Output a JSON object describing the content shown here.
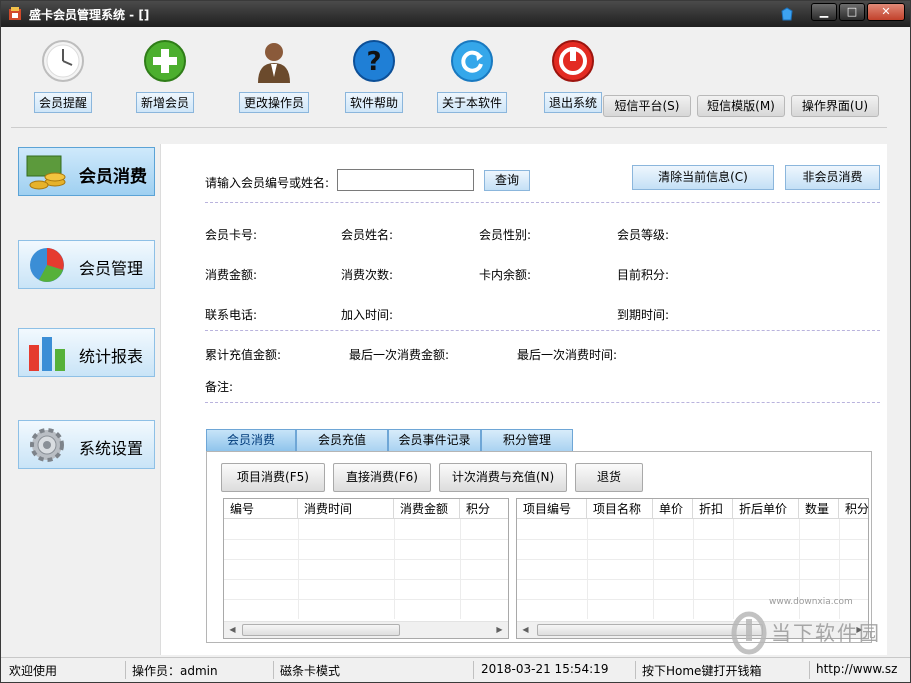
{
  "window": {
    "title": "盛卡会员管理系统 - []",
    "controls": {
      "minimize": "▁",
      "maximize": "□",
      "close": "✕"
    }
  },
  "toolbar": {
    "buttons": [
      {
        "label": "会员提醒",
        "icon": "clock-icon"
      },
      {
        "label": "新增会员",
        "icon": "add-icon"
      },
      {
        "label": "更改操作员",
        "icon": "person-icon"
      },
      {
        "label": "软件帮助",
        "icon": "help-icon"
      },
      {
        "label": "关于本软件",
        "icon": "refresh-icon"
      },
      {
        "label": "退出系统",
        "icon": "power-icon"
      }
    ],
    "tabs": [
      {
        "label": "短信平台(S)"
      },
      {
        "label": "短信模版(M)"
      },
      {
        "label": "操作界面(U)"
      }
    ]
  },
  "sidebar": {
    "items": [
      {
        "label": "会员消费",
        "icon": "money-icon",
        "active": true
      },
      {
        "label": "会员管理",
        "icon": "pie-chart-icon",
        "active": false
      },
      {
        "label": "统计报表",
        "icon": "bar-chart-icon",
        "active": false
      },
      {
        "label": "系统设置",
        "icon": "gear-icon",
        "active": false
      }
    ]
  },
  "search": {
    "prompt": "请输入会员编号或姓名:",
    "value": "",
    "query_label": "查询",
    "clear_label": "清除当前信息(C)",
    "nonmember_label": "非会员消费"
  },
  "info": {
    "card_no": "会员卡号:",
    "name": "会员姓名:",
    "gender": "会员性别:",
    "level": "会员等级:",
    "spend_amount": "消费金额:",
    "spend_count": "消费次数:",
    "balance": "卡内余额:",
    "points": "目前积分:",
    "phone": "联系电话:",
    "join_time": "加入时间:",
    "expire_time": "到期时间:",
    "total_recharge": "累计充值金额:",
    "last_amount": "最后一次消费金额:",
    "last_time": "最后一次消费时间:",
    "remark": "备注:"
  },
  "tabs": [
    {
      "label": "会员消费",
      "active": true
    },
    {
      "label": "会员充值",
      "active": false
    },
    {
      "label": "会员事件记录",
      "active": false
    },
    {
      "label": "积分管理",
      "active": false
    }
  ],
  "actions": [
    {
      "label": "项目消费(F5)"
    },
    {
      "label": "直接消费(F6)"
    },
    {
      "label": "计次消费与充值(N)"
    },
    {
      "label": "退货"
    }
  ],
  "left_grid": {
    "columns": [
      "编号",
      "消费时间",
      "消费金额",
      "积分"
    ]
  },
  "right_grid": {
    "columns": [
      "项目编号",
      "项目名称",
      "单价",
      "折扣",
      "折后单价",
      "数量",
      "积分"
    ]
  },
  "status": {
    "welcome": "欢迎使用",
    "operator": "操作员：admin",
    "mode": "磁条卡模式",
    "datetime": "2018-03-21 15:54:19",
    "hint": "按下Home键打开钱箱",
    "url": "http://www.sz"
  },
  "watermark": {
    "text": "当下软件园",
    "url": "www.downxia.com"
  }
}
